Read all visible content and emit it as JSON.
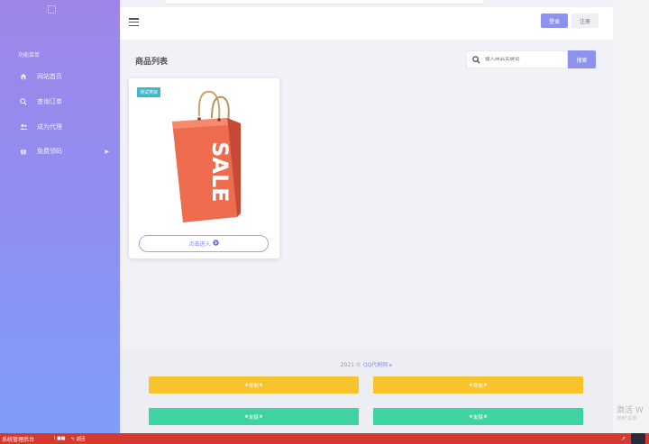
{
  "sidebar": {
    "menu_title": "功能菜单",
    "items": [
      {
        "icon": "home-icon",
        "label": "网站首页"
      },
      {
        "icon": "search-icon",
        "label": "查询订单"
      },
      {
        "icon": "users-icon",
        "label": "成为代理"
      },
      {
        "icon": "gift-icon",
        "label": "免费领码"
      }
    ]
  },
  "header": {
    "login_label": "登录",
    "register_label": "注册"
  },
  "main": {
    "title": "商品列表",
    "search_placeholder": "输入商品关键词",
    "search_button": "搜索"
  },
  "product": {
    "tag": "测试类目",
    "enter_button": "点击进入"
  },
  "footer": {
    "copyright_prefix": "2021 ©",
    "copyright_link": "QQ代刷网",
    "buttons": [
      {
        "label": "导航",
        "color": "#f7c42c"
      },
      {
        "label": "导航",
        "color": "#f7c42c"
      },
      {
        "label": "友链",
        "color": "#3ed3a0"
      },
      {
        "label": "友链",
        "color": "#3ed3a0"
      }
    ]
  },
  "watermark": {
    "title": "激活 W",
    "sub": "转到\"设置"
  },
  "taskbar": {
    "title": "系统管理后台",
    "item1": "I ■■",
    "item2": "↰ 返回"
  },
  "colors": {
    "accent": "#8c92ee",
    "sidebar_top": "#9e86e8",
    "sidebar_bottom": "#7f9dfa",
    "taskbar": "#d6392e"
  }
}
